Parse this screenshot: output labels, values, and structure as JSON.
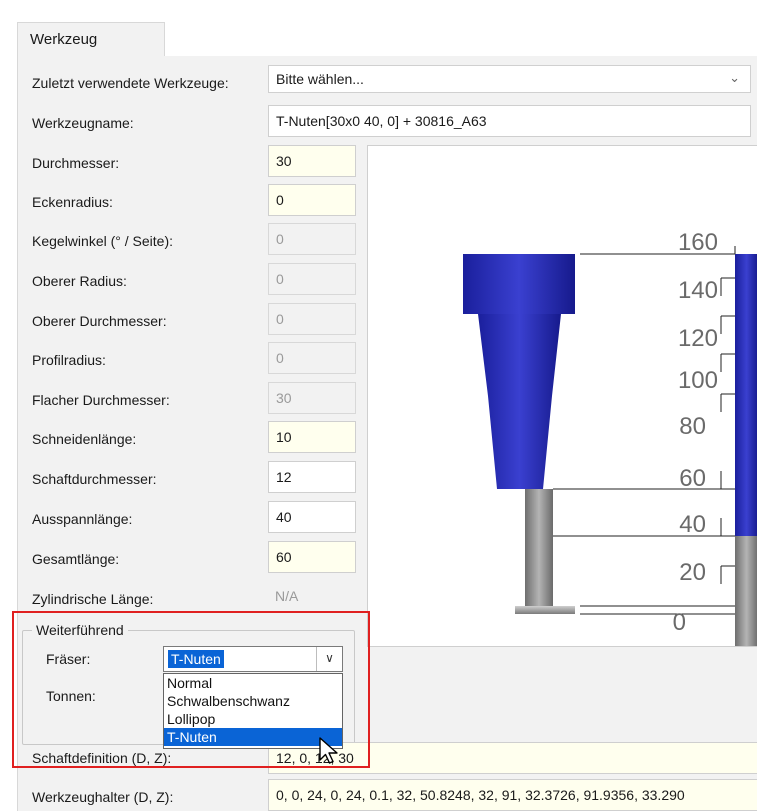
{
  "tab": {
    "label": "Werkzeug"
  },
  "recent_tools": {
    "label": "Zuletzt verwendete Werkzeuge:",
    "value": "Bitte wählen..."
  },
  "tool_name": {
    "label": "Werkzeugname:",
    "value": "T-Nuten[30x0 40, 0] + 30816_A63"
  },
  "params": {
    "durchmesser": {
      "label": "Durchmesser:",
      "value": "30"
    },
    "eckenradius": {
      "label": "Eckenradius:",
      "value": "0"
    },
    "kegelwinkel": {
      "label": "Kegelwinkel (° / Seite):",
      "value": "0"
    },
    "oberer_radius": {
      "label": "Oberer Radius:",
      "value": "0"
    },
    "oberer_durchmesser": {
      "label": "Oberer Durchmesser:",
      "value": "0"
    },
    "profilradius": {
      "label": "Profilradius:",
      "value": "0"
    },
    "flacher_durchmesser": {
      "label": "Flacher Durchmesser:",
      "value": "30"
    },
    "schneidenlaenge": {
      "label": "Schneidenlänge:",
      "value": "10"
    },
    "schaftdurchmesser": {
      "label": "Schaftdurchmesser:",
      "value": "12"
    },
    "ausspannlaenge": {
      "label": "Ausspannlänge:",
      "value": "40"
    },
    "gesamtlaenge": {
      "label": "Gesamtlänge:",
      "value": "60"
    },
    "zylindrische_laenge": {
      "label": "Zylindrische Länge:",
      "value": "N/A"
    }
  },
  "advanced": {
    "title": "Weiterführend",
    "fraeser_label": "Fräser:",
    "fraeser_value": "T-Nuten",
    "tonnen_label": "Tonnen:",
    "options": [
      "Normal",
      "Schwalbenschwanz",
      "Lollipop",
      "T-Nuten"
    ]
  },
  "shaft_definition": {
    "label": "Schaftdefinition (D, Z):",
    "value": "12, 0, 12, 30"
  },
  "tool_holder": {
    "label": "Werkzeughalter (D, Z):",
    "value": "0, 0, 24, 0, 24, 0.1, 32, 50.8248, 32, 91, 32.3726, 91.9356, 33.290"
  },
  "preview": {
    "ruler_ticks": [
      "160",
      "140",
      "120",
      "100",
      "80",
      "60",
      "40",
      "20",
      "0"
    ],
    "colors": {
      "holder": "#2a2fb5",
      "shaft": "#8a8a8a",
      "highlight": "#e02020"
    }
  }
}
